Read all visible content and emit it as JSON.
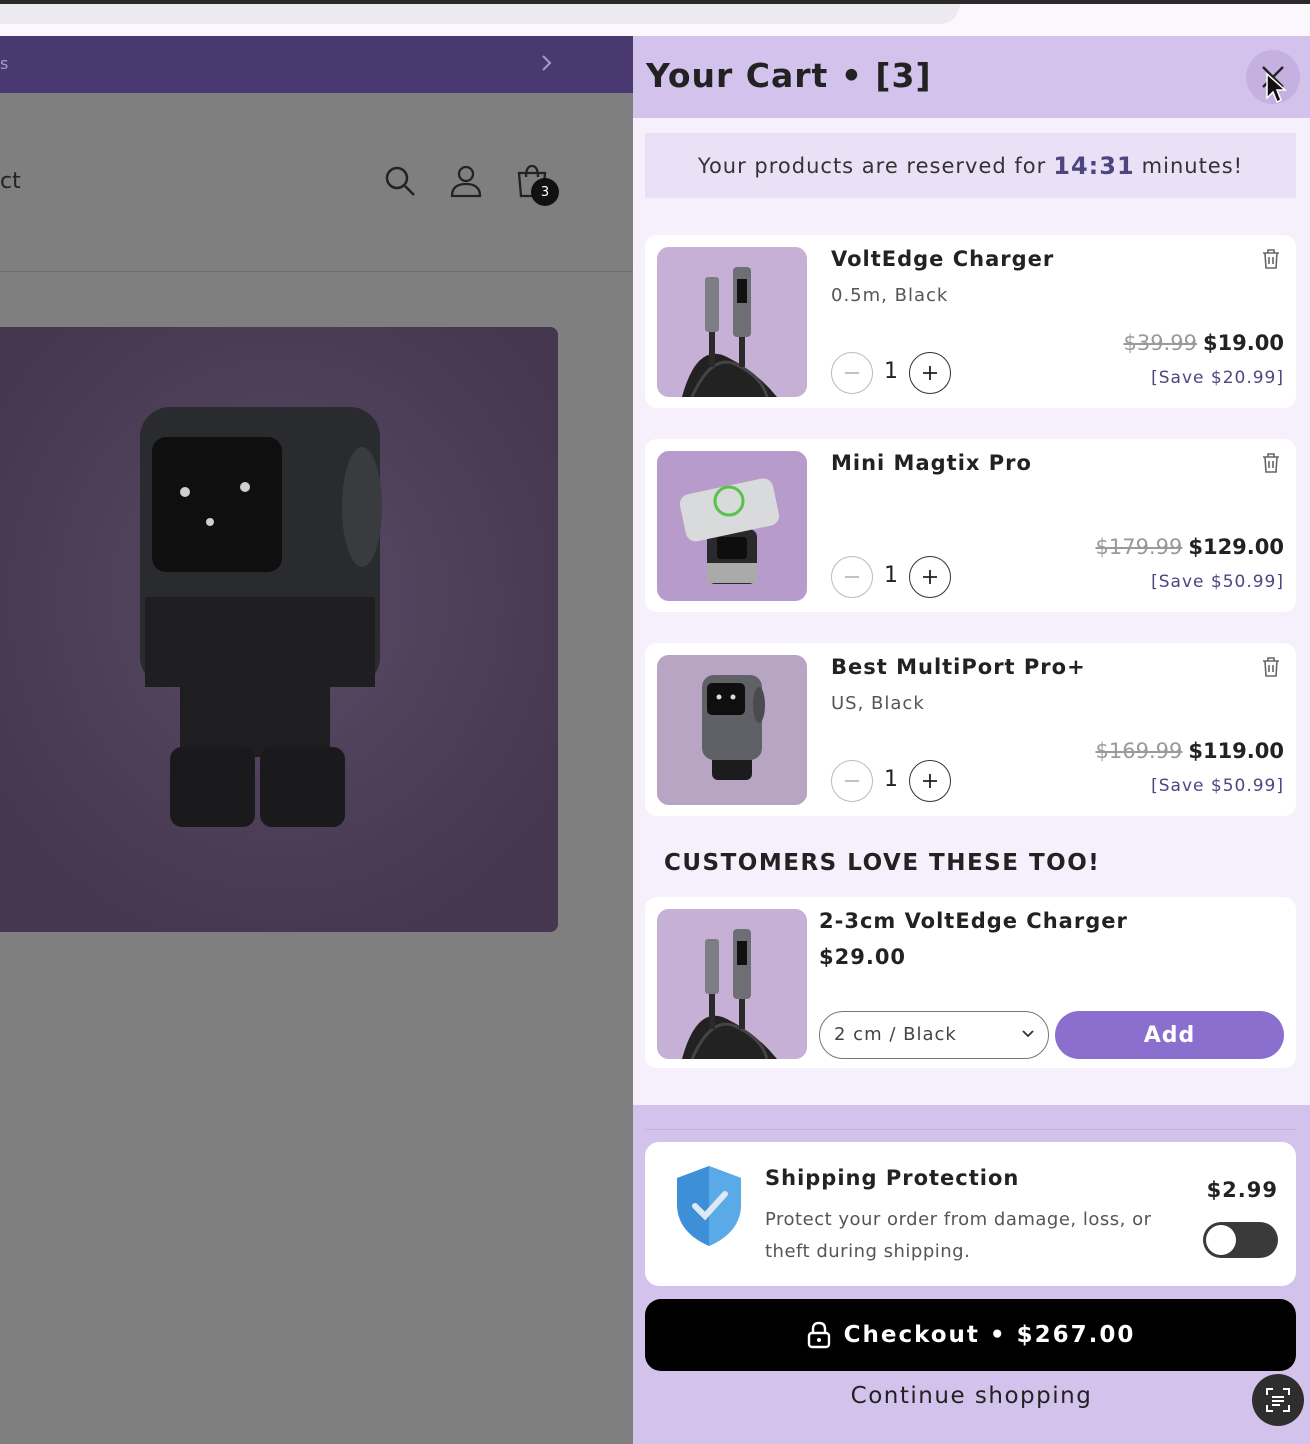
{
  "background": {
    "announcement_text": "s",
    "nav_partial_text": "ct",
    "cart_count": "3"
  },
  "cart": {
    "title": "Your Cart • [3]",
    "reserve": {
      "prefix": "Your products are reserved for",
      "timer": "14:31",
      "suffix": "minutes!"
    },
    "items": [
      {
        "name": "VoltEdge Charger",
        "variant": "0.5m, Black",
        "qty": "1",
        "old_price": "$39.99",
        "new_price": "$19.00",
        "save": "[Save $20.99]"
      },
      {
        "name": "Mini Magtix Pro",
        "variant": "",
        "qty": "1",
        "old_price": "$179.99",
        "new_price": "$129.00",
        "save": "[Save $50.99]"
      },
      {
        "name": "Best MultiPort Pro+",
        "variant": "US, Black",
        "qty": "1",
        "old_price": "$169.99",
        "new_price": "$119.00",
        "save": "[Save $50.99]"
      }
    ],
    "upsell": {
      "heading": "CUSTOMERS LOVE THESE TOO!",
      "name": "2-3cm VoltEdge Charger",
      "price": "$29.00",
      "selected_option": "2 cm / Black",
      "add_label": "Add"
    },
    "protection": {
      "title": "Shipping Protection",
      "description": "Protect your order from damage, loss, or theft during shipping.",
      "price": "$2.99",
      "enabled": false
    },
    "checkout_label": "Checkout • $267.00",
    "continue_label": "Continue shopping"
  },
  "colors": {
    "drawer_header": "#d3c2ec",
    "accent": "#8b6fcf",
    "timer": "#4b4680",
    "announcement": "#4a3970"
  },
  "icons": [
    "close-icon",
    "trash-icon",
    "minus-icon",
    "plus-icon",
    "chevron-down-icon",
    "shield-check-icon",
    "lock-icon",
    "scan-icon",
    "search-icon",
    "user-icon",
    "cart-icon",
    "chevron-right-icon"
  ]
}
